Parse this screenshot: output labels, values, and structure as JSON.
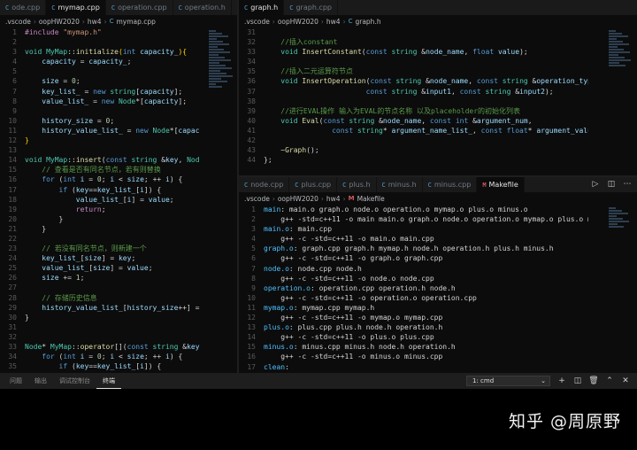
{
  "left_editor": {
    "tabs": [
      {
        "label": "ode.cpp",
        "icon": "C"
      },
      {
        "label": "mymap.cpp",
        "icon": "C",
        "active": true
      },
      {
        "label": "operation.cpp",
        "icon": "C"
      },
      {
        "label": "operation.h",
        "icon": "C"
      }
    ],
    "breadcrumb": [
      ".vscode",
      "oopHW2020",
      "hw4",
      "C",
      "mymap.cpp"
    ],
    "first_line": 1
  },
  "right_top_editor": {
    "tabs": [
      {
        "label": "graph.h",
        "icon": "C",
        "active": true
      },
      {
        "label": "graph.cpp",
        "icon": "C"
      }
    ],
    "breadcrumb": [
      ".vscode",
      "oopHW2020",
      "hw4",
      "C",
      "graph.h"
    ],
    "first_line": 31
  },
  "right_bottom_editor": {
    "tabs": [
      {
        "label": "node.cpp",
        "icon": "C"
      },
      {
        "label": "plus.cpp",
        "icon": "C"
      },
      {
        "label": "plus.h",
        "icon": "C"
      },
      {
        "label": "minus.h",
        "icon": "C"
      },
      {
        "label": "minus.cpp",
        "icon": "C"
      },
      {
        "label": "Makefile",
        "icon": "M",
        "active": true
      }
    ],
    "breadcrumb": [
      ".vscode",
      "oopHW2020",
      "hw4",
      "M",
      "Makefile"
    ],
    "first_line": 1
  },
  "panel": {
    "tabs": [
      "问题",
      "输出",
      "调试控制台",
      "终端"
    ],
    "active_tab": "终端",
    "terminal_select": "1: cmd",
    "icons": [
      "plus-icon",
      "split-icon",
      "trash-icon",
      "chevron-up-icon",
      "close-icon"
    ]
  },
  "watermark": "知乎 @周原野",
  "colors": {
    "keyword": "#569cd6",
    "type": "#4ec9b0",
    "function": "#dcdcaa",
    "variable": "#9cdcfe",
    "number": "#b5cea8",
    "string": "#ce9178",
    "comment": "#5a9a4a"
  },
  "left_code": [
    [
      [
        "pp",
        "#include "
      ],
      [
        "st",
        "\"mymap.h\""
      ]
    ],
    [],
    [
      [
        "ty",
        "void "
      ],
      [
        "ty",
        "MyMap"
      ],
      [
        "op",
        "::"
      ],
      [
        "fn",
        "initialize"
      ],
      [
        "br",
        "("
      ],
      [
        "kw",
        "int "
      ],
      [
        "va",
        "capacity_"
      ],
      [
        "br",
        ")"
      ],
      [
        "br",
        "{"
      ]
    ],
    [
      [
        "op",
        "    "
      ],
      [
        "va",
        "capacity"
      ],
      [
        "op",
        " = "
      ],
      [
        "va",
        "capacity_"
      ],
      [
        "op",
        ";"
      ]
    ],
    [],
    [
      [
        "op",
        "    "
      ],
      [
        "va",
        "size"
      ],
      [
        "op",
        " = "
      ],
      [
        "nu",
        "0"
      ],
      [
        "op",
        ";"
      ]
    ],
    [
      [
        "op",
        "    "
      ],
      [
        "va",
        "key_list_"
      ],
      [
        "op",
        " = "
      ],
      [
        "kw",
        "new "
      ],
      [
        "ty",
        "string"
      ],
      [
        "op",
        "["
      ],
      [
        "va",
        "capacity"
      ],
      [
        "op",
        "];"
      ]
    ],
    [
      [
        "op",
        "    "
      ],
      [
        "va",
        "value_list_"
      ],
      [
        "op",
        " = "
      ],
      [
        "kw",
        "new "
      ],
      [
        "ty",
        "Node"
      ],
      [
        "op",
        "*["
      ],
      [
        "va",
        "capacity"
      ],
      [
        "op",
        "];"
      ]
    ],
    [],
    [
      [
        "op",
        "    "
      ],
      [
        "va",
        "history_size"
      ],
      [
        "op",
        " = "
      ],
      [
        "nu",
        "0"
      ],
      [
        "op",
        ";"
      ]
    ],
    [
      [
        "op",
        "    "
      ],
      [
        "va",
        "history_value_list_"
      ],
      [
        "op",
        " = "
      ],
      [
        "kw",
        "new "
      ],
      [
        "ty",
        "Node"
      ],
      [
        "op",
        "*["
      ],
      [
        "va",
        "capac"
      ]
    ],
    [
      [
        "br",
        "}"
      ]
    ],
    [],
    [
      [
        "ty",
        "void "
      ],
      [
        "ty",
        "MyMap"
      ],
      [
        "op",
        "::"
      ],
      [
        "fn",
        "insert"
      ],
      [
        "op",
        "("
      ],
      [
        "kw",
        "const "
      ],
      [
        "ty",
        "string "
      ],
      [
        "op",
        "&"
      ],
      [
        "va",
        "key"
      ],
      [
        "op",
        ", "
      ],
      [
        "ty",
        "Nod"
      ]
    ],
    [
      [
        "op",
        "    "
      ],
      [
        "cm",
        "// 查看是否有同名节点，若有则替换"
      ]
    ],
    [
      [
        "op",
        "    "
      ],
      [
        "kw",
        "for "
      ],
      [
        "op",
        "("
      ],
      [
        "kw",
        "int "
      ],
      [
        "va",
        "i"
      ],
      [
        "op",
        " = "
      ],
      [
        "nu",
        "0"
      ],
      [
        "op",
        "; "
      ],
      [
        "va",
        "i"
      ],
      [
        "op",
        " < "
      ],
      [
        "va",
        "size"
      ],
      [
        "op",
        "; "
      ],
      [
        "op",
        "++ "
      ],
      [
        "va",
        "i"
      ],
      [
        "op",
        ") {"
      ]
    ],
    [
      [
        "op",
        "        "
      ],
      [
        "kw",
        "if "
      ],
      [
        "op",
        "("
      ],
      [
        "va",
        "key"
      ],
      [
        "op",
        "=="
      ],
      [
        "va",
        "key_list_"
      ],
      [
        "op",
        "["
      ],
      [
        "va",
        "i"
      ],
      [
        "op",
        "]) {"
      ]
    ],
    [
      [
        "op",
        "            "
      ],
      [
        "va",
        "value_list_"
      ],
      [
        "op",
        "["
      ],
      [
        "va",
        "i"
      ],
      [
        "op",
        "] = "
      ],
      [
        "va",
        "value"
      ],
      [
        "op",
        ";"
      ]
    ],
    [
      [
        "op",
        "            "
      ],
      [
        "pp",
        "return"
      ],
      [
        "op",
        ";"
      ]
    ],
    [
      [
        "op",
        "        }"
      ]
    ],
    [
      [
        "op",
        "    }"
      ]
    ],
    [],
    [
      [
        "op",
        "    "
      ],
      [
        "cm",
        "// 若没有同名节点，则新建一个"
      ]
    ],
    [
      [
        "op",
        "    "
      ],
      [
        "va",
        "key_list_"
      ],
      [
        "op",
        "["
      ],
      [
        "va",
        "size"
      ],
      [
        "op",
        "] = "
      ],
      [
        "va",
        "key"
      ],
      [
        "op",
        ";"
      ]
    ],
    [
      [
        "op",
        "    "
      ],
      [
        "va",
        "value_list_"
      ],
      [
        "op",
        "["
      ],
      [
        "va",
        "size"
      ],
      [
        "op",
        "] = "
      ],
      [
        "va",
        "value"
      ],
      [
        "op",
        ";"
      ]
    ],
    [
      [
        "op",
        "    "
      ],
      [
        "va",
        "size"
      ],
      [
        "op",
        " += "
      ],
      [
        "nu",
        "1"
      ],
      [
        "op",
        ";"
      ]
    ],
    [],
    [
      [
        "op",
        "    "
      ],
      [
        "cm",
        "// 存储历史信息"
      ]
    ],
    [
      [
        "op",
        "    "
      ],
      [
        "va",
        "history_value_list_"
      ],
      [
        "op",
        "["
      ],
      [
        "va",
        "history_size"
      ],
      [
        "op",
        "++] ="
      ]
    ],
    [
      [
        "op",
        "}"
      ]
    ],
    [],
    [],
    [
      [
        "ty",
        "Node"
      ],
      [
        "op",
        "* "
      ],
      [
        "ty",
        "MyMap"
      ],
      [
        "op",
        "::"
      ],
      [
        "fn",
        "operator"
      ],
      [
        "op",
        "[]("
      ],
      [
        "kw",
        "const "
      ],
      [
        "ty",
        "string "
      ],
      [
        "op",
        "&"
      ],
      [
        "va",
        "key"
      ]
    ],
    [
      [
        "op",
        "    "
      ],
      [
        "kw",
        "for "
      ],
      [
        "op",
        "("
      ],
      [
        "kw",
        "int "
      ],
      [
        "va",
        "i"
      ],
      [
        "op",
        " = "
      ],
      [
        "nu",
        "0"
      ],
      [
        "op",
        "; "
      ],
      [
        "va",
        "i"
      ],
      [
        "op",
        " < "
      ],
      [
        "va",
        "size"
      ],
      [
        "op",
        "; "
      ],
      [
        "op",
        "++ "
      ],
      [
        "va",
        "i"
      ],
      [
        "op",
        ") {"
      ]
    ],
    [
      [
        "op",
        "        "
      ],
      [
        "kw",
        "if "
      ],
      [
        "op",
        "("
      ],
      [
        "va",
        "key"
      ],
      [
        "op",
        "=="
      ],
      [
        "va",
        "key_list_"
      ],
      [
        "op",
        "["
      ],
      [
        "va",
        "i"
      ],
      [
        "op",
        "]) {"
      ]
    ]
  ],
  "right_top_code": [
    [],
    [
      [
        "op",
        "    "
      ],
      [
        "cm",
        "//插入constant"
      ]
    ],
    [
      [
        "op",
        "    "
      ],
      [
        "ty",
        "void "
      ],
      [
        "fn",
        "InsertConstant"
      ],
      [
        "op",
        "("
      ],
      [
        "kw",
        "const "
      ],
      [
        "ty",
        "string "
      ],
      [
        "op",
        "&"
      ],
      [
        "va",
        "node_name"
      ],
      [
        "op",
        ", "
      ],
      [
        "kw",
        "float "
      ],
      [
        "va",
        "value"
      ],
      [
        "op",
        ");"
      ]
    ],
    [],
    [
      [
        "op",
        "    "
      ],
      [
        "cm",
        "//插入二元运算符节点"
      ]
    ],
    [
      [
        "op",
        "    "
      ],
      [
        "ty",
        "void "
      ],
      [
        "fn",
        "InsertOperation"
      ],
      [
        "op",
        "("
      ],
      [
        "kw",
        "const "
      ],
      [
        "ty",
        "string "
      ],
      [
        "op",
        "&"
      ],
      [
        "va",
        "node_name"
      ],
      [
        "op",
        ", "
      ],
      [
        "kw",
        "const "
      ],
      [
        "ty",
        "string "
      ],
      [
        "op",
        "&"
      ],
      [
        "va",
        "operation_type"
      ]
    ],
    [
      [
        "op",
        "                        "
      ],
      [
        "kw",
        "const "
      ],
      [
        "ty",
        "string "
      ],
      [
        "op",
        "&"
      ],
      [
        "va",
        "input1"
      ],
      [
        "op",
        ", "
      ],
      [
        "kw",
        "const "
      ],
      [
        "ty",
        "string "
      ],
      [
        "op",
        "&"
      ],
      [
        "va",
        "input2"
      ],
      [
        "op",
        ");"
      ]
    ],
    [],
    [
      [
        "op",
        "    "
      ],
      [
        "cm",
        "//进行EVAL操作 输入为EVAL的节点名称 以及placeholder的初始化列表"
      ]
    ],
    [
      [
        "op",
        "    "
      ],
      [
        "ty",
        "void "
      ],
      [
        "fn",
        "Eval"
      ],
      [
        "op",
        "("
      ],
      [
        "kw",
        "const "
      ],
      [
        "ty",
        "string "
      ],
      [
        "op",
        "&"
      ],
      [
        "va",
        "node_name"
      ],
      [
        "op",
        ", "
      ],
      [
        "kw",
        "const "
      ],
      [
        "kw",
        "int "
      ],
      [
        "op",
        "&"
      ],
      [
        "va",
        "argument_num"
      ],
      [
        "op",
        ","
      ]
    ],
    [
      [
        "op",
        "                "
      ],
      [
        "kw",
        "const "
      ],
      [
        "ty",
        "string"
      ],
      [
        "op",
        "* "
      ],
      [
        "va",
        "argument_name_list_"
      ],
      [
        "op",
        ", "
      ],
      [
        "kw",
        "const "
      ],
      [
        "kw",
        "float"
      ],
      [
        "op",
        "* "
      ],
      [
        "va",
        "argument_value"
      ]
    ],
    [],
    [
      [
        "op",
        "    "
      ],
      [
        "op",
        "~"
      ],
      [
        "fn",
        "Graph"
      ],
      [
        "op",
        "();"
      ]
    ],
    [
      [
        "op",
        "};"
      ]
    ]
  ],
  "makefile_code": [
    [
      [
        "mk-t",
        "main"
      ],
      [
        "mk-c",
        ": main.o graph.o node.o operation.o mymap.o plus.o minus.o"
      ]
    ],
    [
      [
        "mk-c",
        "    g++ -std=c++11 -o main main.o graph.o node.o operation.o mymap.o plus.o minus.o"
      ]
    ],
    [
      [
        "mk-t",
        "main.o"
      ],
      [
        "mk-c",
        ": main.cpp"
      ]
    ],
    [
      [
        "mk-c",
        "    g++ -c -std=c++11 -o main.o main.cpp"
      ]
    ],
    [
      [
        "mk-t",
        "graph.o"
      ],
      [
        "mk-c",
        ": graph.cpp graph.h mymap.h node.h operation.h plus.h minus.h"
      ]
    ],
    [
      [
        "mk-c",
        "    g++ -c -std=c++11 -o graph.o graph.cpp"
      ]
    ],
    [
      [
        "mk-t",
        "node.o"
      ],
      [
        "mk-c",
        ": node.cpp node.h"
      ]
    ],
    [
      [
        "mk-c",
        "    g++ -c -std=c++11 -o node.o node.cpp"
      ]
    ],
    [
      [
        "mk-t",
        "operation.o"
      ],
      [
        "mk-c",
        ": operation.cpp operation.h node.h"
      ]
    ],
    [
      [
        "mk-c",
        "    g++ -c -std=c++11 -o operation.o operation.cpp"
      ]
    ],
    [
      [
        "mk-t",
        "mymap.o"
      ],
      [
        "mk-c",
        ": mymap.cpp mymap.h"
      ]
    ],
    [
      [
        "mk-c",
        "    g++ -c -std=c++11 -o mymap.o mymap.cpp"
      ]
    ],
    [
      [
        "mk-t",
        "plus.o"
      ],
      [
        "mk-c",
        ": plus.cpp plus.h node.h operation.h"
      ]
    ],
    [
      [
        "mk-c",
        "    g++ -c -std=c++11 -o plus.o plus.cpp"
      ]
    ],
    [
      [
        "mk-t",
        "minus.o"
      ],
      [
        "mk-c",
        ": minus.cpp minus.h node.h operation.h"
      ]
    ],
    [
      [
        "mk-c",
        "    g++ -c -std=c++11 -o minus.o minus.cpp"
      ]
    ],
    [
      [
        "mk-t",
        "clean"
      ],
      [
        "mk-c",
        ":"
      ]
    ]
  ]
}
